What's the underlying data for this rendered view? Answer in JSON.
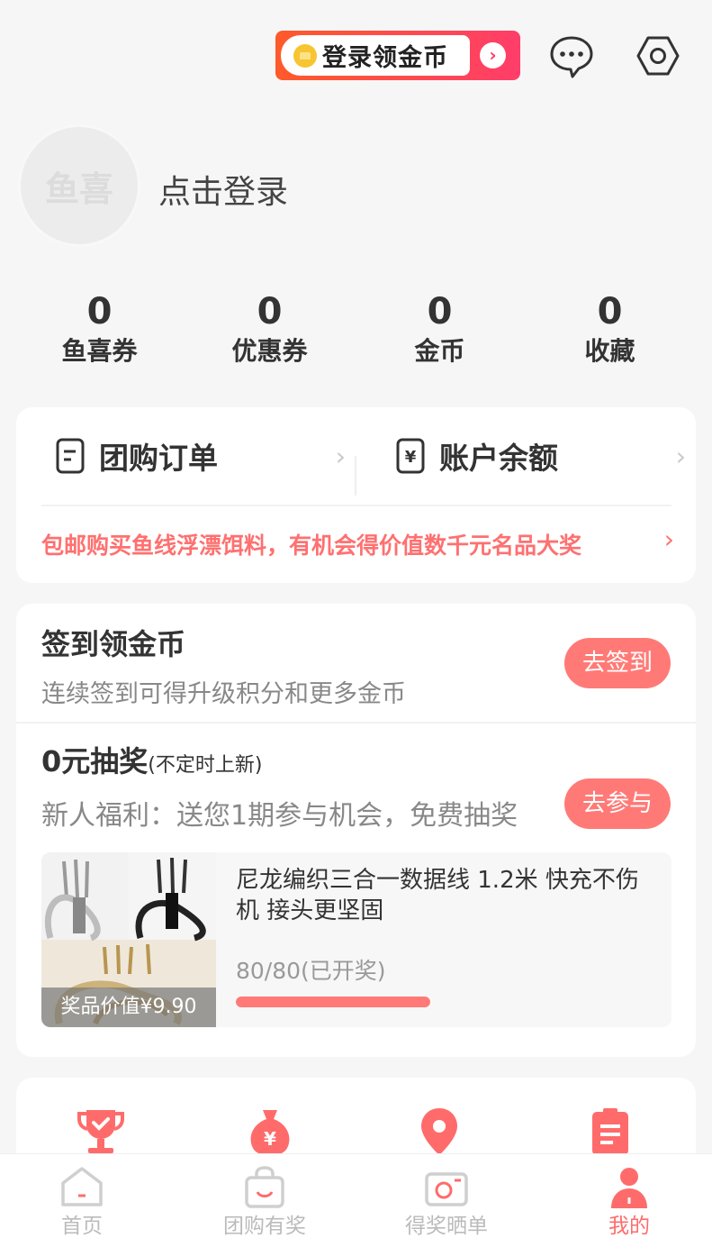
{
  "topbar": {
    "login_coin_label": "登录领金币",
    "arrow": "›"
  },
  "profile": {
    "avatar_text": "鱼喜",
    "login_text": "点击登录"
  },
  "stats": [
    {
      "value": "0",
      "label": "鱼喜券"
    },
    {
      "value": "0",
      "label": "优惠券"
    },
    {
      "value": "0",
      "label": "金币"
    },
    {
      "value": "0",
      "label": "收藏"
    }
  ],
  "orders": {
    "group_order": "团购订单",
    "balance": "账户余额",
    "balance_icon_glyph": "¥",
    "chevron": "›",
    "promo": "包邮购买鱼线浮漂饵料，有机会得价值数千元名品大奖"
  },
  "signin": {
    "title": "签到领金币",
    "subtitle": "连续签到可得升级积分和更多金币",
    "button": "去签到"
  },
  "lottery": {
    "title": "0元抽奖",
    "title_note": "(不定时上新)",
    "subtitle": "新人福利：送您1期参与机会，免费抽奖",
    "button": "去参与",
    "prize": {
      "name": "尼龙编织三合一数据线 1.2米 快充不伤机 接头更坚固",
      "badge": "奖品价值¥9.90",
      "count": "80/80(已开奖)",
      "progress_percent": 100
    }
  },
  "tabbar": [
    {
      "label": "首页",
      "icon": "home-icon",
      "active": false
    },
    {
      "label": "团购有奖",
      "icon": "bag-icon",
      "active": false
    },
    {
      "label": "得奖晒单",
      "icon": "camera-icon",
      "active": false
    },
    {
      "label": "我的",
      "icon": "person-icon",
      "active": true
    }
  ],
  "colors": {
    "accent": "#ff7a76",
    "promo": "#ff7070",
    "banner_start": "#ff5a2a",
    "banner_end": "#ff3d6a"
  }
}
